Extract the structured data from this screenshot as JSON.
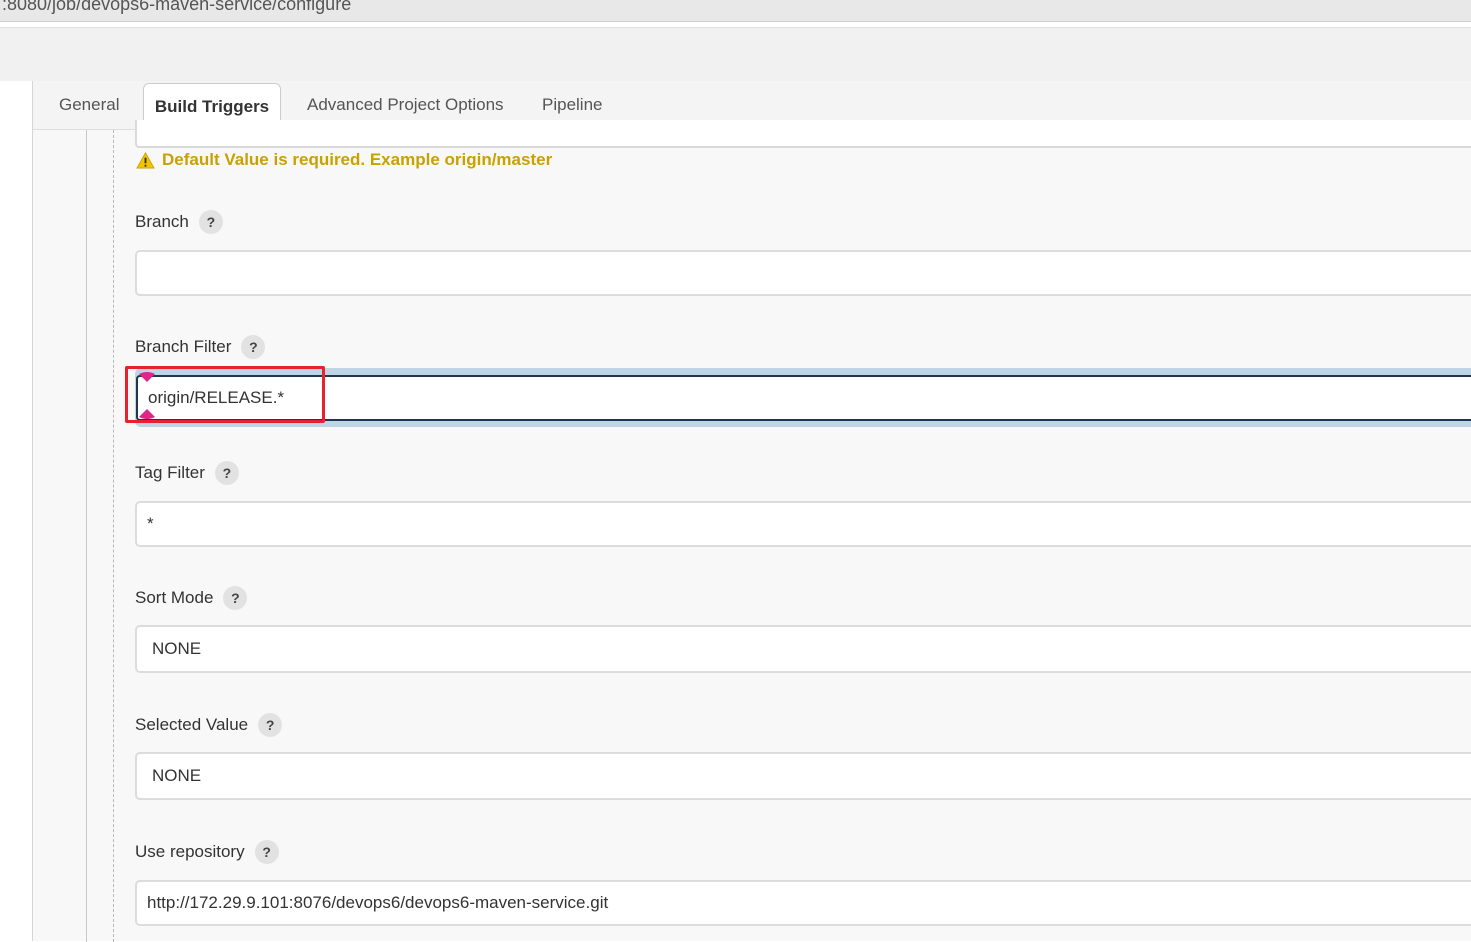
{
  "browser": {
    "url": ":8080/job/devops6-maven-service/configure"
  },
  "tabs": [
    {
      "label": "General",
      "active": false
    },
    {
      "label": "Build Triggers",
      "active": true
    },
    {
      "label": "Advanced Project Options",
      "active": false
    },
    {
      "label": "Pipeline",
      "active": false
    }
  ],
  "warning": {
    "text": "Default Value is required. Example origin/master",
    "icon": "warning-icon",
    "color": "#c9a100"
  },
  "help_symbol": "?",
  "fields": {
    "branch": {
      "label": "Branch",
      "value": ""
    },
    "branch_filter": {
      "label": "Branch Filter",
      "value": "origin/RELEASE.*"
    },
    "tag_filter": {
      "label": "Tag Filter",
      "value": "*"
    },
    "sort_mode": {
      "label": "Sort Mode",
      "value": "NONE"
    },
    "selected_value": {
      "label": "Selected Value",
      "value": "NONE"
    },
    "use_repository": {
      "label": "Use repository",
      "value": "http://172.29.9.101:8076/devops6/devops6-maven-service.git"
    }
  },
  "colors": {
    "highlight": "#e8212e",
    "focus_border": "#1f3550",
    "focus_ring": "#bfd4e4"
  }
}
